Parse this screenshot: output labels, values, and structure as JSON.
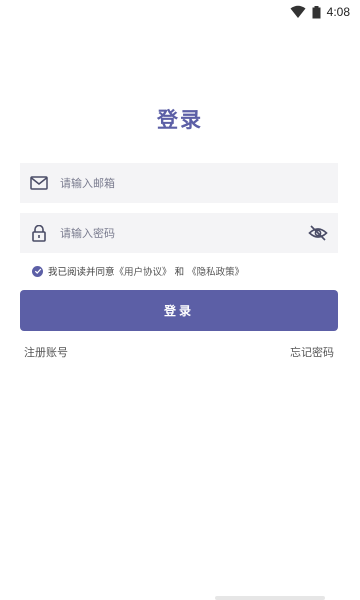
{
  "status_bar": {
    "time": "4:08"
  },
  "page": {
    "title": "登录"
  },
  "email": {
    "placeholder": "请输入邮箱",
    "value": ""
  },
  "password": {
    "placeholder": "请输入密码",
    "value": ""
  },
  "agreement": {
    "prefix": "我已阅读并同意",
    "user_agreement": "《用户协议》",
    "and": "和",
    "privacy_policy": "《隐私政策》",
    "checked": true
  },
  "login_button": {
    "label": "登录"
  },
  "links": {
    "register": "注册账号",
    "forgot_password": "忘记密码"
  },
  "colors": {
    "accent": "#5c5fa6",
    "field_bg": "#f4f4f6"
  },
  "icons": [
    "wifi-icon",
    "battery-icon",
    "mail-icon",
    "lock-icon",
    "eye-off-icon",
    "check-icon"
  ]
}
